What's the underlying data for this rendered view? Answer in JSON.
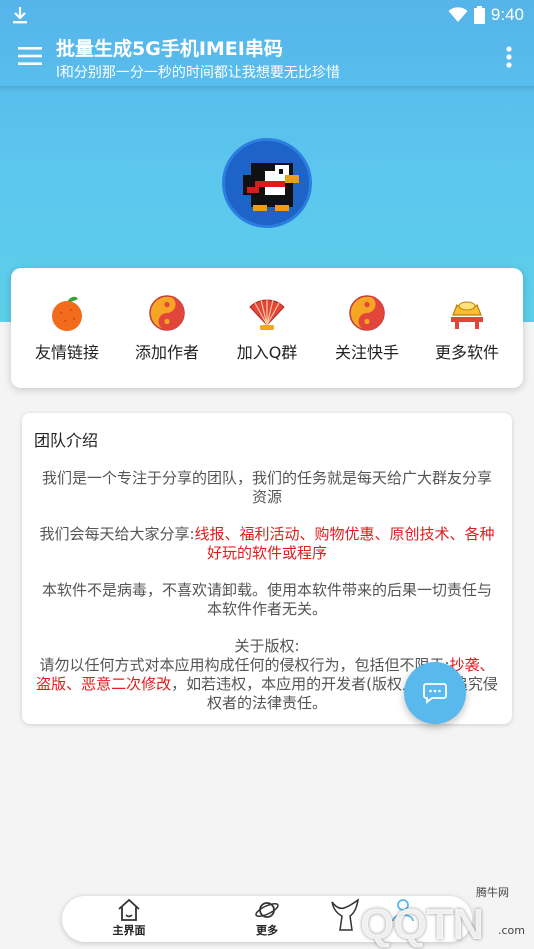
{
  "statusbar": {
    "time": "9:40"
  },
  "appbar": {
    "title": "批量生成5G手机IMEI串码",
    "subtitle": "l和分别那一分一秒的时间都让我想要无比珍惜"
  },
  "quick_links": [
    {
      "label": "友情链接",
      "icon": "tangerine-icon"
    },
    {
      "label": "添加作者",
      "icon": "yin-yang-icon"
    },
    {
      "label": "加入Q群",
      "icon": "folding-fan-icon"
    },
    {
      "label": "关注快手",
      "icon": "yin-yang-icon"
    },
    {
      "label": "更多软件",
      "icon": "gold-ingot-icon"
    }
  ],
  "intro": {
    "heading": "团队介绍",
    "p1": "我们是一个专注于分享的团队，我们的任务就是每天给广大群友分享资源",
    "p2_prefix": "我们会每天给大家分享:",
    "p2_highlight": "线报、福利活动、购物优惠、原创技术、各种好玩的软件或程序",
    "p3": "本软件不是病毒，不喜欢请卸载。使用本软件带来的后果一切责任与本软件作者无关。",
    "p4_title": "关于版权:",
    "p4_prefix": "请勿以任何方式对本应用构成任何的侵权行为，包括但不限于:",
    "p4_highlight": "抄袭、盗版、恶意二次修改",
    "p4_suffix": "，如若违权，本应用的开发者(版权人)必当追究侵权者的法律责任。"
  },
  "bottom_nav": [
    {
      "label": "主界面",
      "icon": "home-icon"
    },
    {
      "label": "更多",
      "icon": "planet-icon"
    },
    {
      "label": "",
      "icon": "person-icon"
    }
  ],
  "watermark": {
    "text": "QQTN",
    "small": "腾牛网",
    "suffix": ".com"
  },
  "colors": {
    "header": "#55b4ea",
    "fab": "#59b9ec",
    "highlight": "#e01d1d"
  }
}
